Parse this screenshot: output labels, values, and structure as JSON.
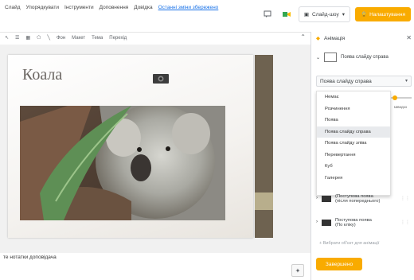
{
  "menu": {
    "items": [
      "Слайд",
      "Упорядкувати",
      "Інструменти",
      "Доповнення",
      "Довідка"
    ],
    "saved_text": "Останні зміни збережено"
  },
  "top_right": {
    "slideshow_label": "Слайд-шоу",
    "access_label": "Налаштування"
  },
  "toolbar": {
    "items": [
      "Фон",
      "Макет",
      "Тема",
      "Перехід"
    ]
  },
  "slide": {
    "title": "Коала"
  },
  "notes": {
    "text": "те нотатки доповідача"
  },
  "panel": {
    "title": "Анімація",
    "transition_row": "Поява слайду справа",
    "select_value": "Поява слайду справа",
    "speed_label": "Швидко",
    "dropdown_options": [
      "Немає",
      "Розчинення",
      "Поява",
      "Поява слайду справа",
      "Поява слайду зліва",
      "Перевертання",
      "Куб",
      "Галерея"
    ],
    "selected_index": 3,
    "speed_value": 0.1,
    "animations": [
      {
        "line1": "(Поступова поява",
        "line2": "(після попереднього)"
      },
      {
        "line1": "Поступова поява",
        "line2": "(По кліку)"
      }
    ],
    "add_label": "+ Вибрати об'єкт для анімації",
    "done_label": "Завершено"
  },
  "colors": {
    "accent": "#f9ab00",
    "band": "#6e6250"
  }
}
